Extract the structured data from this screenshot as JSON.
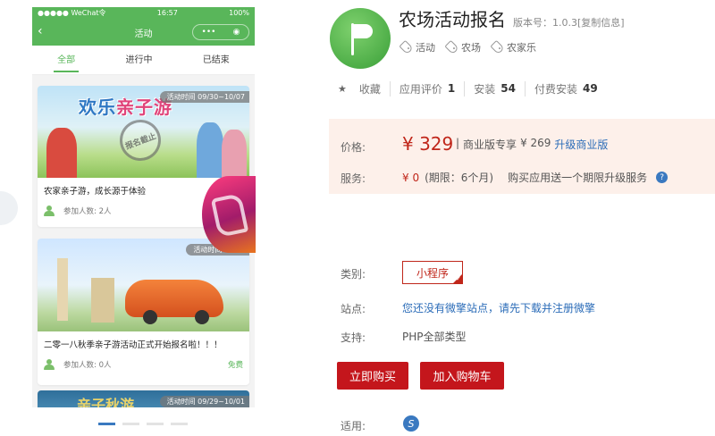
{
  "phone": {
    "status": {
      "carrier": "●●●●● WeChat令",
      "time": "16:57",
      "battery": "100%"
    },
    "nav": {
      "title": "活动",
      "back_icon": "chevron-left-icon",
      "more": "•••",
      "close": "◉"
    },
    "tabs": [
      "全部",
      "进行中",
      "已结束"
    ],
    "cards": [
      {
        "banner_text_a": "欢乐",
        "banner_text_b": "亲子游",
        "stamp": "报名截止",
        "date": "活动时间 09/30~10/07",
        "title": "农家亲子游，成长源于体验",
        "participants": "参加人数: 2人",
        "price": ""
      },
      {
        "date": "活动时间 10/01",
        "title": "二零一八秋季亲子游活动正式开始报名啦！！！",
        "participants": "参加人数: 0人",
        "price": "免费"
      },
      {
        "banner_text_a": "亲子秋游",
        "date": "活动时间 09/29~10/01"
      }
    ]
  },
  "product": {
    "title": "农场活动报名",
    "version": "版本号：1.0.3",
    "copy_info": "[复制信息]",
    "tags": [
      "活动",
      "农场",
      "农家乐"
    ],
    "stats": {
      "favorite": "收藏",
      "rating_label": "应用评价",
      "rating_value": "1",
      "install_label": "安装",
      "install_value": "54",
      "paid_install_label": "付费安装",
      "paid_install_value": "49"
    },
    "price_label": "价格:",
    "price": "¥ 329",
    "price_sep": "|",
    "business_label": "商业版专享",
    "business_price": "¥ 269",
    "upgrade_link": "升级商业版",
    "service_label": "服务:",
    "service_price": "¥ 0",
    "service_period": "(期限：6个月)",
    "service_desc": "购买应用送一个期限升级服务",
    "help": "?",
    "category_label": "类别:",
    "category_value": "小程序",
    "site_label": "站点:",
    "site_value": "您还没有微擎站点，请先下载并注册微擎",
    "support_label": "支持:",
    "support_value": "PHP全部类型",
    "buy_button": "立即购买",
    "cart_button": "加入购物车",
    "apply_label": "适用:",
    "apply_icon": "mini-program-icon"
  },
  "colors": {
    "wechat_green": "#59b65a",
    "price_red": "#c0261a",
    "button_red": "#c4161c",
    "link_blue": "#2b6cb8",
    "price_bg": "#fdf0ea"
  }
}
